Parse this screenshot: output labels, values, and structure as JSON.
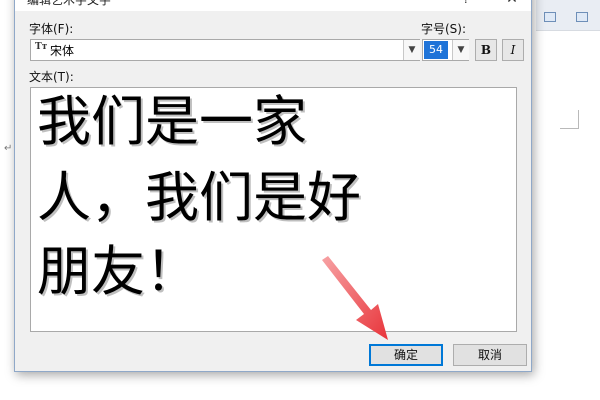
{
  "dialog": {
    "title": "编辑艺术字文字",
    "help_label": "?",
    "close_label": "✕",
    "font_label": "字体(F):",
    "font_value": "宋体",
    "font_icon": "truetype-icon",
    "size_label": "字号(S):",
    "size_value": "54",
    "bold_label": "B",
    "italic_label": "I",
    "text_label": "文本(T):",
    "text_lines": [
      "我们是一家",
      "人，我们是好",
      "朋友！"
    ],
    "ok_label": "确定",
    "cancel_label": "取消"
  },
  "annotation": {
    "arrow_color": "#e8343a",
    "arrow_icon": "red-arrow-icon"
  },
  "colors": {
    "selection": "#1e73d8",
    "default_button_border": "#0078d7"
  }
}
